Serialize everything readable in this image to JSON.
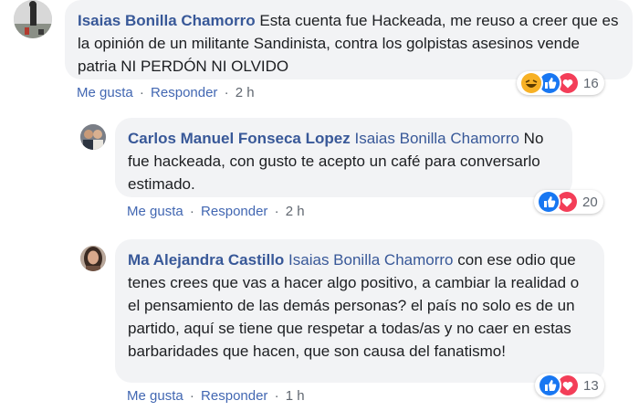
{
  "actions": {
    "like": "Me gusta",
    "reply": "Responder",
    "separator": "·"
  },
  "comments": [
    {
      "author": "Isaias Bonilla Chamorro",
      "mention": "",
      "text": "Esta cuenta fue Hackeada, me reuso a creer que es la opinión de un militante Sandinista, contra los golpistas asesinos vende patria NI PERDÓN NI OLVIDO",
      "time": "2 h",
      "reaction_count": "16",
      "reactions": [
        "haha-icon",
        "like-icon",
        "love-icon"
      ]
    },
    {
      "author": "Carlos Manuel Fonseca Lopez",
      "mention": "Isaias Bonilla Chamorro",
      "text": "No fue hackeada, con gusto te acepto un café para conversarlo estimado.",
      "time": "2 h",
      "reaction_count": "20",
      "reactions": [
        "like-icon",
        "love-icon"
      ]
    },
    {
      "author": "Ma Alejandra Castillo",
      "mention": "Isaias Bonilla Chamorro",
      "text": "con ese odio que tenes crees que vas a hacer algo positivo, a cambiar la realidad o el pensamiento de las demás personas? el país no solo es de un partido, aquí se tiene que respetar a todas/as y no caer en estas barbaridades que hacen, que son causa del fanatismo!",
      "time": "1 h",
      "reaction_count": "13",
      "reactions": [
        "like-icon",
        "love-icon"
      ]
    }
  ],
  "colors": {
    "link": "#385898",
    "bubble": "#f2f3f5",
    "like": "#1877f2",
    "love": "#f33e58",
    "haha": "#f7b125"
  }
}
